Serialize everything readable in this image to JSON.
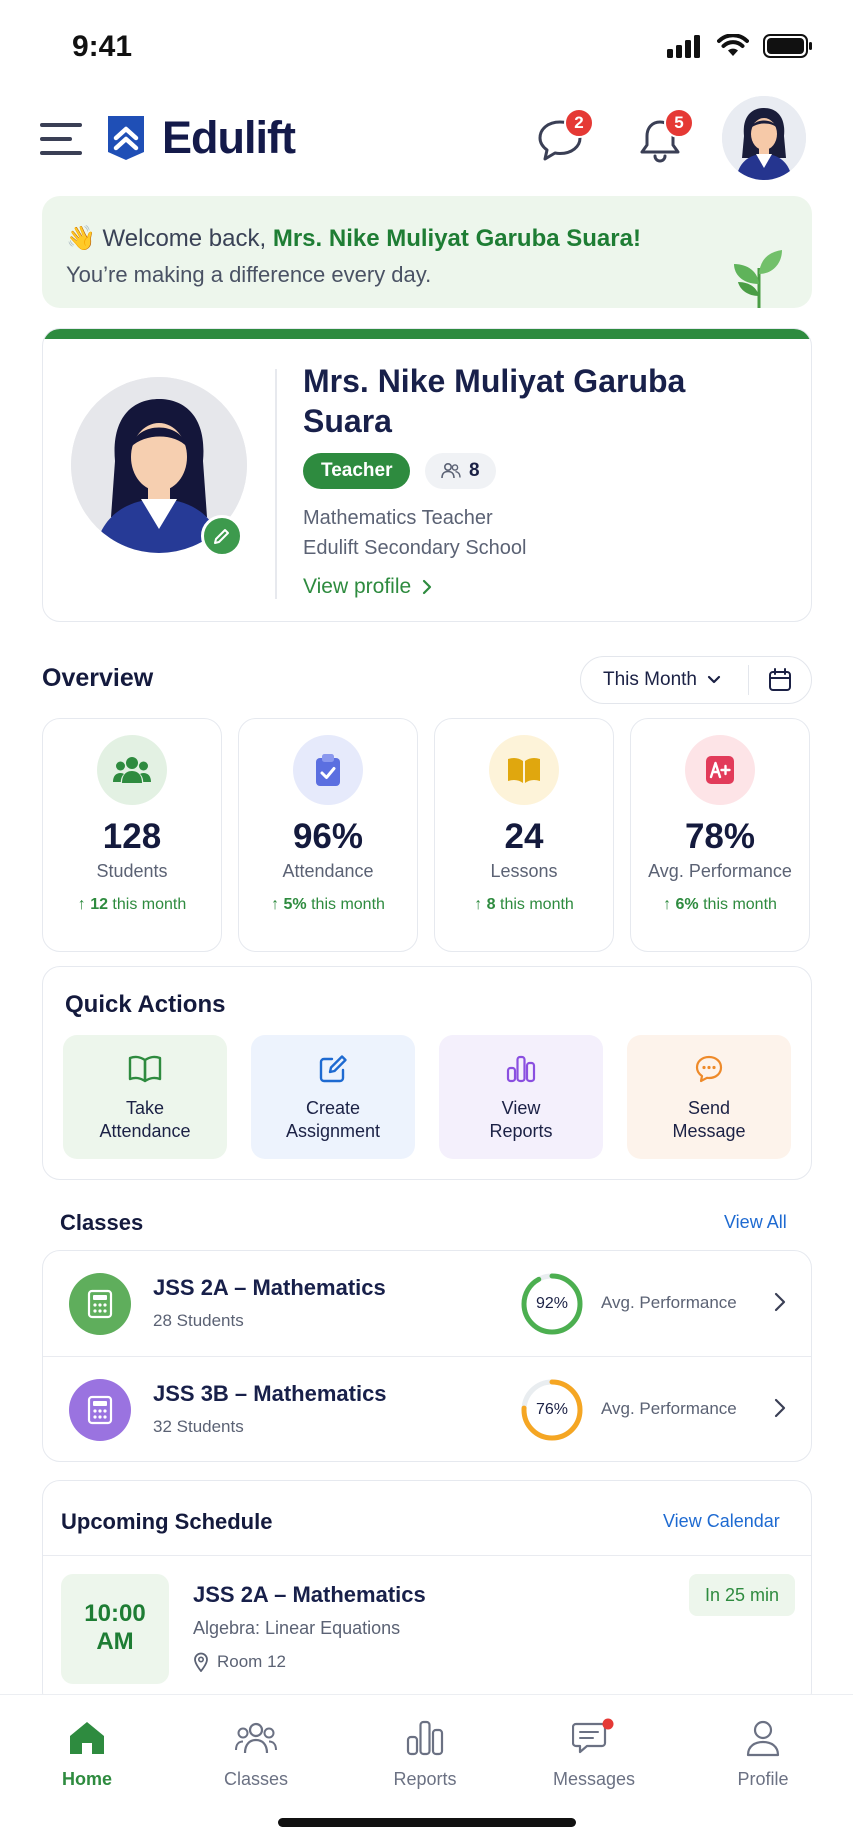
{
  "status_bar": {
    "time": "9:41"
  },
  "header": {
    "app_name": "Edulift",
    "messages_badge": "2",
    "notifications_badge": "5"
  },
  "welcome": {
    "greeting": "👋 Welcome back, ",
    "name": "Mrs. Nike Muliyat Garuba Suara!",
    "subtitle": "You’re making a difference every day."
  },
  "profile": {
    "name": "Mrs. Nike Muliyat Garuba Suara",
    "role": "Teacher",
    "classes_count": "8",
    "title": "Mathematics Teacher",
    "school": "Edulift Secondary School",
    "view_profile": "View profile"
  },
  "overview": {
    "title": "Overview",
    "period": "This Month",
    "stats": [
      {
        "value": "128",
        "label": "Students",
        "delta": "12",
        "delta_suffix": " this month"
      },
      {
        "value": "96%",
        "label": "Attendance",
        "delta": "5%",
        "delta_suffix": " this month"
      },
      {
        "value": "24",
        "label": "Lessons",
        "delta": "8",
        "delta_suffix": " this month"
      },
      {
        "value": "78%",
        "label": "Avg. Performance",
        "delta": "6%",
        "delta_suffix": " this month"
      }
    ]
  },
  "quick_actions": {
    "title": "Quick Actions",
    "items": [
      {
        "label": "Take\nAttendance"
      },
      {
        "label": "Create\nAssignment"
      },
      {
        "label": "View\nReports"
      },
      {
        "label": "Send\nMessage"
      }
    ]
  },
  "classes": {
    "title": "Classes",
    "view_all": "View All",
    "items": [
      {
        "name": "JSS 2A – Mathematics",
        "students": "28 Students",
        "performance": 92,
        "performance_label": "92%",
        "metric": "Avg. Performance",
        "color": "#4caf50"
      },
      {
        "name": "JSS 3B – Mathematics",
        "students": "32 Students",
        "performance": 76,
        "performance_label": "76%",
        "metric": "Avg. Performance",
        "color": "#f5a623"
      }
    ]
  },
  "schedule": {
    "title": "Upcoming Schedule",
    "view_calendar": "View Calendar",
    "item": {
      "time": "10:00",
      "ampm": "AM",
      "title": "JSS 2A – Mathematics",
      "topic": "Algebra: Linear Equations",
      "room": "Room 12",
      "starts_in": "In 25 min"
    }
  },
  "bottom_nav": {
    "items": [
      {
        "label": "Home",
        "active": true
      },
      {
        "label": "Classes"
      },
      {
        "label": "Reports"
      },
      {
        "label": "Messages"
      },
      {
        "label": "Profile"
      }
    ]
  },
  "colors": {
    "brand_green": "#2e8b3f",
    "brand_blue": "#1f4fb6",
    "link_blue": "#1e6ad1",
    "badge_red": "#e53935"
  }
}
